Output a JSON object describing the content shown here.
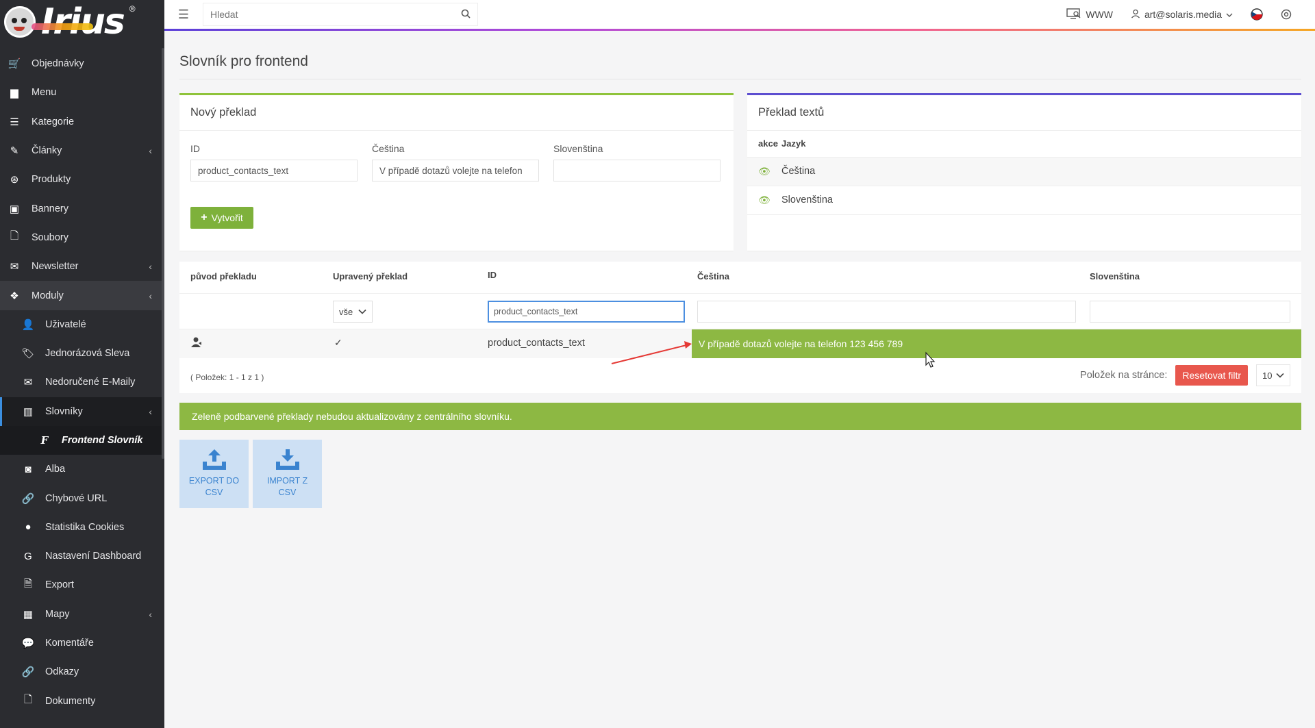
{
  "brand": {
    "logo_text": "Irius",
    "logo_reg": "®"
  },
  "sidebar": {
    "items": [
      {
        "label": "Objednávky",
        "icon": "cart-icon",
        "glyph": "🛒"
      },
      {
        "label": "Menu",
        "icon": "folder-icon",
        "glyph": "▆"
      },
      {
        "label": "Kategorie",
        "icon": "list-icon",
        "glyph": "☰"
      },
      {
        "label": "Články",
        "icon": "pen-icon",
        "glyph": "✎",
        "chev": "‹"
      },
      {
        "label": "Produkty",
        "icon": "product-icon",
        "glyph": "⊛"
      },
      {
        "label": "Bannery",
        "icon": "image-icon",
        "glyph": "▣"
      },
      {
        "label": "Soubory",
        "icon": "file-icon",
        "glyph": "🗋"
      },
      {
        "label": "Newsletter",
        "icon": "newsletter-icon",
        "glyph": "✉",
        "chev": "‹"
      },
      {
        "label": "Moduly",
        "icon": "modules-icon",
        "glyph": "❖",
        "chev": "‹"
      },
      {
        "label": "Uživatelé",
        "icon": "user-icon",
        "glyph": "👤"
      },
      {
        "label": "Jednorázová Sleva",
        "icon": "tag-icon",
        "glyph": "🏷"
      },
      {
        "label": "Nedoručené E-Maily",
        "icon": "email-icon",
        "glyph": "✉"
      },
      {
        "label": "Slovníky",
        "icon": "books-icon",
        "glyph": "▥",
        "chev": "‹"
      },
      {
        "label": "Frontend Slovník",
        "icon": "f-icon",
        "glyph": "F"
      },
      {
        "label": "Alba",
        "icon": "camera-icon",
        "glyph": "◙"
      },
      {
        "label": "Chybové URL",
        "icon": "link-icon",
        "glyph": "🔗"
      },
      {
        "label": "Statistika Cookies",
        "icon": "cookie-icon",
        "glyph": "●"
      },
      {
        "label": "Nastavení Dashboard",
        "icon": "google-icon",
        "glyph": "G"
      },
      {
        "label": "Export",
        "icon": "export-icon",
        "glyph": "🗎"
      },
      {
        "label": "Mapy",
        "icon": "map-icon",
        "glyph": "▦",
        "chev": "‹"
      },
      {
        "label": "Komentáře",
        "icon": "comments-icon",
        "glyph": "💬"
      },
      {
        "label": "Odkazy",
        "icon": "link-icon",
        "glyph": "🔗"
      },
      {
        "label": "Dokumenty",
        "icon": "doc-icon",
        "glyph": "🗋"
      }
    ]
  },
  "topbar": {
    "search_placeholder": "Hledat",
    "www_label": "WWW",
    "user_label": "art@solaris.media"
  },
  "page": {
    "title": "Slovník pro frontend"
  },
  "new_translation": {
    "title": "Nový překlad",
    "id_label": "ID",
    "id_value": "product_contacts_text",
    "cs_label": "Čeština",
    "cs_value": "V případě dotazů volejte na telefon",
    "sk_label": "Slovenština",
    "sk_value": "",
    "create_label": "Vytvořit"
  },
  "text_translation": {
    "title": "Překlad textů",
    "col_action": "akce",
    "col_lang": "Jazyk",
    "rows": [
      "Čeština",
      "Slovenština"
    ]
  },
  "main_table": {
    "headers": {
      "origin": "původ překladu",
      "edited": "Upravený překlad",
      "id": "ID",
      "cs": "Čeština",
      "sk": "Slovenština"
    },
    "filter_select": "vše",
    "filter_id": "product_contacts_text",
    "row": {
      "edited_mark": "✓",
      "id": "product_contacts_text",
      "cs": "V případě dotazů volejte na telefon 123 456 789"
    },
    "items_summary": "( Položek: 1 - 1 z 1 )",
    "per_page_label": "Položek na stránce:",
    "reset_label": "Resetovat filtr",
    "per_page_value": "10"
  },
  "notice": "Zeleně podbarvené překlady nebudou aktualizovány z centrálního slovníku.",
  "csv": {
    "export_line1": "EXPORT DO",
    "export_line2": "CSV",
    "import_line1": "IMPORT Z",
    "import_line2": "CSV"
  },
  "colors": {
    "sidebar_bg": "#2b2c30",
    "green": "#8db843",
    "red_button": "#e8574d",
    "active_blue": "#3b8fe0"
  }
}
